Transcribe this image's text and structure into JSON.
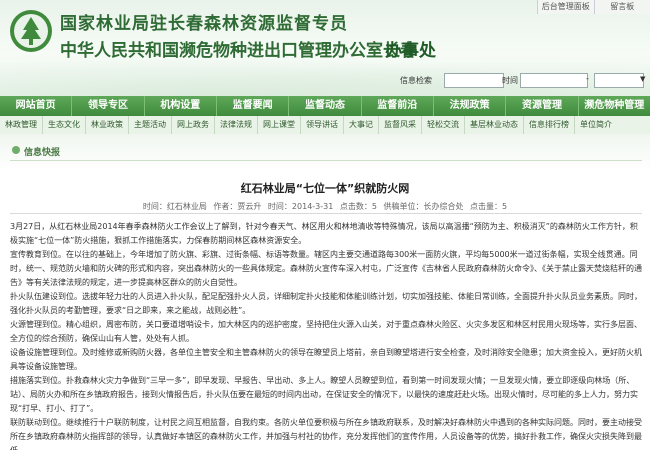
{
  "header": {
    "title_line1": "国家林业局驻长春森林资源监督专员",
    "title_line2": "中华人民共和国濒危物种进出口管理办公室长春",
    "title_suffix": "办事处",
    "toplinks": [
      "后台管理面板",
      "留言板"
    ],
    "search_label": "信息检索",
    "time_label": "时间",
    "range_sep": "-",
    "dropdown_arrow": "▼"
  },
  "nav": {
    "items": [
      "网站首页",
      "领导专区",
      "机构设置",
      "监督要闻",
      "监督动态",
      "监督前沿",
      "法规政策",
      "资源管理",
      "濒危物种管理"
    ]
  },
  "subnav": {
    "items": [
      "林政管理",
      "生态文化",
      "林业政策",
      "主题活动",
      "网上政务",
      "法律法规",
      "网上课堂",
      "领导讲话",
      "大事记",
      "监督风采",
      "轻松交流",
      "基层林业动态",
      "信息排行榜",
      "单位简介"
    ]
  },
  "breadcrumb": {
    "label": "信息快报"
  },
  "article": {
    "title": "红石林业局“七位一体”织就防火网",
    "meta": "时间：红石林业局  作者：贾云升  时间：2014-3-31  点击数：5  供稿单位：长办综合处  点击量：5",
    "paragraphs": [
      "3月27日，从红石林业局2014年春季森林防火工作会议上了解到，针对今春天气、林区用火和林地清收等特殊情况，该局以高温播“预防为主、积极消灭”的森林防火工作方针，积极实施“七位一体”防火措施，狠抓工作措施落实，力保春防期间林区森林资源安全。",
      "宣传教育到位。在以往的基础上，今年增加了防火旗、彩旗、过街条幅、标语等数量。辖区内主要交通道路每300米一面防火旗，平均每5000米一道过街条幅，实现全线贯通。同时，统一、规范防火墙和防火碑的形式和内容，突出森林防火的一些具体规定。森林防火宣传车深入村屯，广泛宣传《吉林省人民政府森林防火命令》、《关于禁止露天焚烧秸秆的通告》等有关法律法规的规定，进一步提高林区群众的防火自觉性。",
      "扑火队伍建设到位。选拔年轻力壮的人员进入扑火队，配足配强扑火人员，详细制定扑火技能和体能训练计划，切实加强技能、体能日常训练，全面提升扑火队员业务素质。同时，强化扑火队员的考勤管理，要求“日之即来，来之能战，战则必胜”。",
      "火源管理到位。精心组织，周密布防，关口要道增哨设卡，加大林区内的巡护密度，坚持把住火源入山关，对于重点森林火险区、火灾多发区和林区村民用火现场等，实行多层面、全方位的综合预防，确保山山有人管，处处有人抓。",
      "设备设施管理到位。及时维修或新购防火器，各单位主管安全和主管森林防火的领导在瞭望员上塔前，亲自到瞭望塔进行安全检查，及时消除安全隐患；加大资金投入，更好防火机具等设备设施管理。",
      "措施落实到位。扑救森林火灾力争做到“三早一多”，即早发现、早报告、早出动、多上人。瞭望人员瞭望到位，看到第一时间发现火情；一旦发现火情，要立即逐级向林场（所、站）、局防火办和所在乡镇政府报告，接到火情报告后，扑火队伍要在最短的时间内出动，在保证安全的情况下，以最快的速度赶赴火场。出现火情时，尽可能的多上人力，努力实现“打早、打小、打了”。",
      "联防联动到位。继续推行十户联防制度，让村民之间互相监督，自我约束。各防火单位要积极与所在乡镇政府联系，及时解决好森林防火中遇到的各种实际问题。同时，要主动接受所在乡镇政府森林防火指挥部的领导，认真做好本镇区的森林防火工作，并加强与村社的协作，充分发挥他们的宣传作用，人员设备等的优势，搞好扑救工作，确保火灾损失降到最低。"
    ]
  },
  "colors": {
    "brand_green": "#3f8a3c",
    "title_green": "#2f6b34"
  }
}
